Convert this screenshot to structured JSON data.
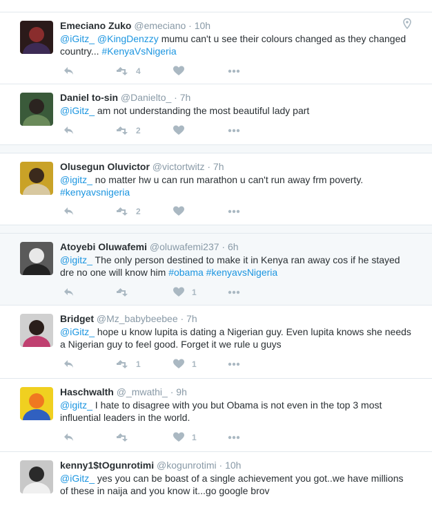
{
  "tweets": [
    {
      "name": "Emeciano Zuko",
      "handle": "@emeciano",
      "sep": "·",
      "time": "10h",
      "parts": [
        {
          "text": "@iGitz_",
          "link": true
        },
        {
          "text": " ",
          "link": false
        },
        {
          "text": "@KingDenzzy",
          "link": true
        },
        {
          "text": " mumu can't u see their colours changed as they changed country... ",
          "link": false
        },
        {
          "text": "#KenyaVsNigeria",
          "link": true
        }
      ],
      "reply_count": "",
      "retweet_count": "4",
      "like_count": "",
      "has_location": true,
      "highlight": false,
      "avatar_colors": [
        "#2b1a1a",
        "#8a2d2d",
        "#3d2b55"
      ]
    },
    {
      "name": "Daniel to-sin",
      "handle": "@Danielto_",
      "sep": "·",
      "time": "7h",
      "parts": [
        {
          "text": "@iGitz_",
          "link": true
        },
        {
          "text": " am not understanding the most beautiful lady part",
          "link": false
        }
      ],
      "reply_count": "",
      "retweet_count": "2",
      "like_count": "",
      "has_location": false,
      "highlight": false,
      "avatar_colors": [
        "#3a5a3a",
        "#2b2420",
        "#6a8a5a"
      ]
    },
    {
      "name": "Olusegun Oluvictor",
      "handle": "@victortwitz",
      "sep": "·",
      "time": "7h",
      "parts": [
        {
          "text": "@igitz_",
          "link": true
        },
        {
          "text": " no matter hw u can run marathon u can't run away frm poverty. ",
          "link": false
        },
        {
          "text": "#kenyavsnigeria",
          "link": true
        }
      ],
      "reply_count": "",
      "retweet_count": "2",
      "like_count": "",
      "has_location": false,
      "highlight": false,
      "avatar_colors": [
        "#c9a227",
        "#3b2a1c",
        "#d8c8a0"
      ]
    },
    {
      "name": "Atoyebi Oluwafemi",
      "handle": "@oluwafemi237",
      "sep": "·",
      "time": "6h",
      "parts": [
        {
          "text": "@igitz_",
          "link": true
        },
        {
          "text": " The only person destined to make it in Kenya ran away cos if he stayed dre no one will know him ",
          "link": false
        },
        {
          "text": "#obama",
          "link": true
        },
        {
          "text": " ",
          "link": false
        },
        {
          "text": "#kenyavsNigeria",
          "link": true
        }
      ],
      "reply_count": "",
      "retweet_count": "",
      "like_count": "1",
      "has_location": false,
      "highlight": true,
      "avatar_colors": [
        "#5a5a5a",
        "#e8e8e8",
        "#222222"
      ]
    },
    {
      "name": "Bridget",
      "handle": "@Mz_babybeebee",
      "sep": "·",
      "time": "7h",
      "parts": [
        {
          "text": "@iGitz_",
          "link": true
        },
        {
          "text": " hope u know lupita is dating a Nigerian guy. Even lupita knows she needs a Nigerian guy to feel good. Forget it we rule u guys",
          "link": false
        }
      ],
      "reply_count": "",
      "retweet_count": "1",
      "like_count": "1",
      "has_location": false,
      "highlight": false,
      "avatar_colors": [
        "#d0d0d0",
        "#2a1e1a",
        "#c04070"
      ]
    },
    {
      "name": "Haschwalth",
      "handle": "@_mwathi_",
      "sep": "·",
      "time": "9h",
      "parts": [
        {
          "text": "@igitz_",
          "link": true
        },
        {
          "text": " I hate to disagree with you but Obama is not even in the top 3 most influential leaders in the world.",
          "link": false
        }
      ],
      "reply_count": "",
      "retweet_count": "",
      "like_count": "1",
      "has_location": false,
      "highlight": false,
      "avatar_colors": [
        "#f0d020",
        "#f07820",
        "#3060c0"
      ]
    },
    {
      "name": "kenny1$tOgunrotimi",
      "handle": "@kogunrotimi",
      "sep": "·",
      "time": "10h",
      "parts": [
        {
          "text": "@iGitz_",
          "link": true
        },
        {
          "text": " yes you can be boast of a single achievement you got..we have millions of these in naija and you know it...go google brov",
          "link": false
        }
      ],
      "reply_count": "",
      "retweet_count": "",
      "like_count": "",
      "has_location": false,
      "highlight": false,
      "avatar_colors": [
        "#c8c8c8",
        "#2a2a2a",
        "#f0f0f0"
      ]
    }
  ]
}
